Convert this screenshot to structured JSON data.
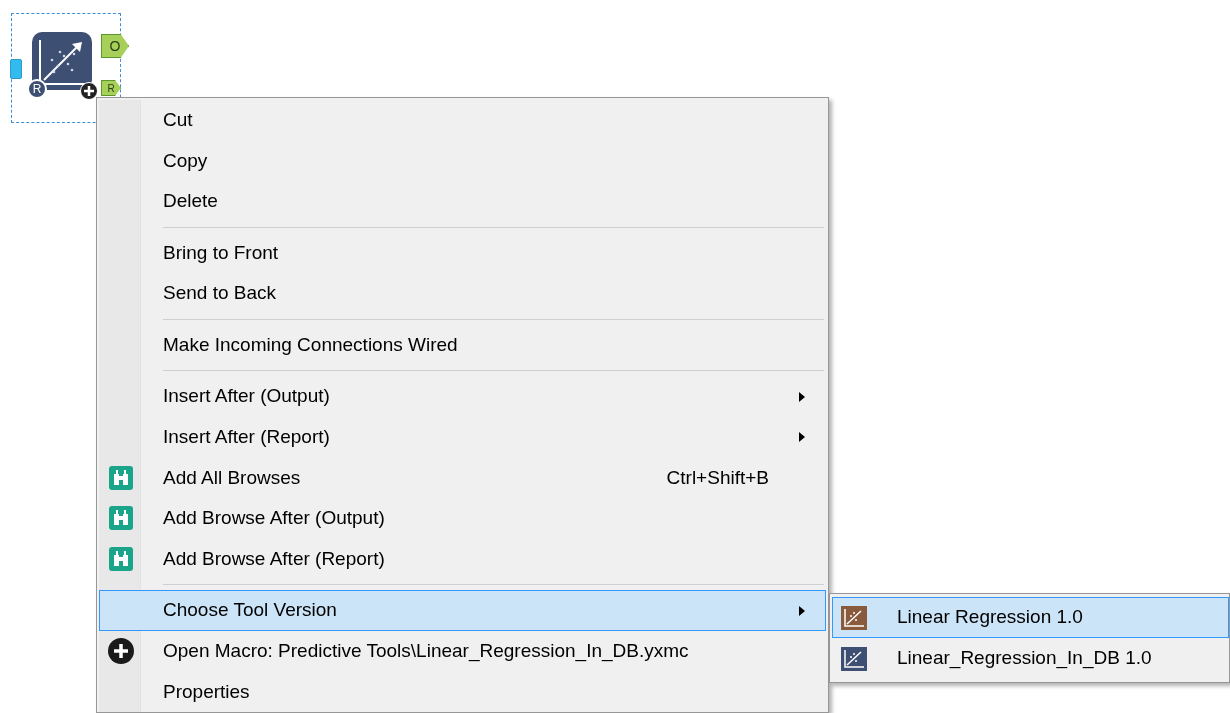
{
  "tool_node": {
    "badge": "R",
    "anchors": [
      {
        "label": "O"
      },
      {
        "label": "R"
      }
    ],
    "selected": true
  },
  "context_menu": {
    "items": [
      {
        "kind": "item",
        "label": "Cut",
        "selected": false
      },
      {
        "kind": "item",
        "label": "Copy",
        "selected": false
      },
      {
        "kind": "item",
        "label": "Delete",
        "selected": false
      },
      {
        "kind": "separator"
      },
      {
        "kind": "item",
        "label": "Bring to Front",
        "selected": false
      },
      {
        "kind": "item",
        "label": "Send to Back",
        "selected": false
      },
      {
        "kind": "separator"
      },
      {
        "kind": "item",
        "label": "Make Incoming Connections Wired",
        "selected": false
      },
      {
        "kind": "separator"
      },
      {
        "kind": "submenu",
        "label": "Insert After (Output)",
        "selected": false
      },
      {
        "kind": "submenu",
        "label": "Insert After (Report)",
        "selected": false
      },
      {
        "kind": "browse",
        "label": "Add All Browses",
        "shortcut": "Ctrl+Shift+B",
        "selected": false
      },
      {
        "kind": "browse",
        "label": "Add Browse After (Output)",
        "selected": false
      },
      {
        "kind": "browse",
        "label": "Add Browse After (Report)",
        "selected": false
      },
      {
        "kind": "separator"
      },
      {
        "kind": "submenu",
        "label": "Choose Tool Version",
        "selected": true
      },
      {
        "kind": "macro",
        "label": "Open Macro: Predictive Tools\\Linear_Regression_In_DB.yxmc",
        "selected": false
      },
      {
        "kind": "item",
        "label": "Properties",
        "selected": false
      }
    ]
  },
  "submenu": {
    "items": [
      {
        "label": "Linear Regression 1.0",
        "color": "#8a5a3c",
        "selected": true
      },
      {
        "label": "Linear_Regression_In_DB 1.0",
        "color": "#3d4f72",
        "selected": false
      }
    ]
  }
}
